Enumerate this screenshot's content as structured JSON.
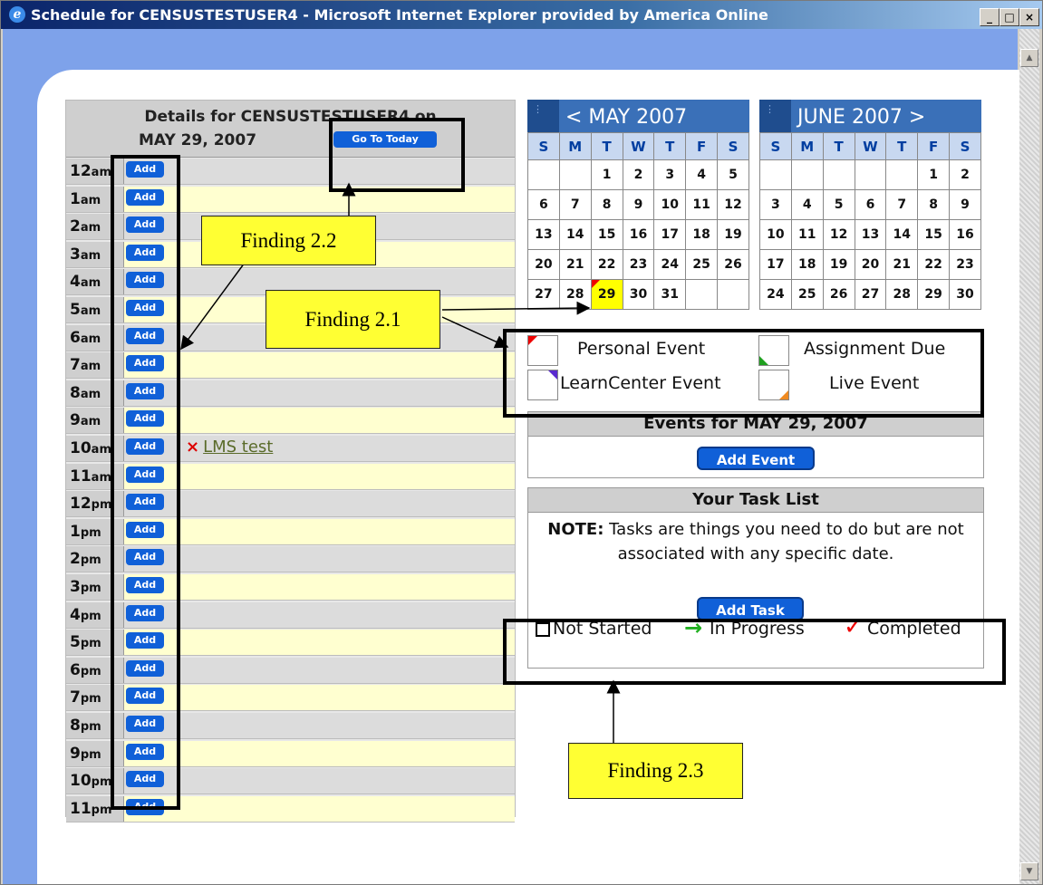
{
  "window": {
    "title": "Schedule for CENSUSTESTUSER4 - Microsoft Internet Explorer provided by America Online",
    "minimize": "_",
    "maximize": "□",
    "close": "×",
    "icon": "ie-icon"
  },
  "details": {
    "heading_line1": "Details for CENSUSTESTUSER4 on",
    "heading_line2": "MAY 29, 2007",
    "goto_today_label": "Go To Today",
    "add_label": "Add",
    "hours": [
      {
        "num": "12",
        "ap": "am"
      },
      {
        "num": "1",
        "ap": "am"
      },
      {
        "num": "2",
        "ap": "am"
      },
      {
        "num": "3",
        "ap": "am"
      },
      {
        "num": "4",
        "ap": "am"
      },
      {
        "num": "5",
        "ap": "am"
      },
      {
        "num": "6",
        "ap": "am"
      },
      {
        "num": "7",
        "ap": "am"
      },
      {
        "num": "8",
        "ap": "am"
      },
      {
        "num": "9",
        "ap": "am"
      },
      {
        "num": "10",
        "ap": "am"
      },
      {
        "num": "11",
        "ap": "am"
      },
      {
        "num": "12",
        "ap": "pm"
      },
      {
        "num": "1",
        "ap": "pm"
      },
      {
        "num": "2",
        "ap": "pm"
      },
      {
        "num": "3",
        "ap": "pm"
      },
      {
        "num": "4",
        "ap": "pm"
      },
      {
        "num": "5",
        "ap": "pm"
      },
      {
        "num": "6",
        "ap": "pm"
      },
      {
        "num": "7",
        "ap": "pm"
      },
      {
        "num": "8",
        "ap": "pm"
      },
      {
        "num": "9",
        "ap": "pm"
      },
      {
        "num": "10",
        "ap": "pm"
      },
      {
        "num": "11",
        "ap": "pm"
      }
    ],
    "event": {
      "hour_index": 10,
      "delete_glyph": "×",
      "label": "LMS test"
    }
  },
  "calendars": [
    {
      "title": "< MAY 2007",
      "days_of_week": [
        "S",
        "M",
        "T",
        "W",
        "T",
        "F",
        "S"
      ],
      "weeks": [
        [
          "",
          "",
          "1",
          "2",
          "3",
          "4",
          "5"
        ],
        [
          "6",
          "7",
          "8",
          "9",
          "10",
          "11",
          "12"
        ],
        [
          "13",
          "14",
          "15",
          "16",
          "17",
          "18",
          "19"
        ],
        [
          "20",
          "21",
          "22",
          "23",
          "24",
          "25",
          "26"
        ],
        [
          "27",
          "28",
          "29",
          "30",
          "31",
          "",
          ""
        ]
      ],
      "today": "29"
    },
    {
      "title": "JUNE 2007 >",
      "days_of_week": [
        "S",
        "M",
        "T",
        "W",
        "T",
        "F",
        "S"
      ],
      "weeks": [
        [
          "",
          "",
          "",
          "",
          "",
          "1",
          "2"
        ],
        [
          "3",
          "4",
          "5",
          "6",
          "7",
          "8",
          "9"
        ],
        [
          "10",
          "11",
          "12",
          "13",
          "14",
          "15",
          "16"
        ],
        [
          "17",
          "18",
          "19",
          "20",
          "21",
          "22",
          "23"
        ],
        [
          "24",
          "25",
          "26",
          "27",
          "28",
          "29",
          "30"
        ]
      ],
      "today": ""
    }
  ],
  "legend": {
    "personal": {
      "label": "Personal Event",
      "color": "#e00000"
    },
    "assignment": {
      "label": "Assignment Due",
      "color": "#20a020"
    },
    "learncenter": {
      "label": "LearnCenter Event",
      "color": "#5a2ad0"
    },
    "live": {
      "label": "Live Event",
      "color": "#f08a20"
    }
  },
  "events_panel": {
    "heading": "Events for MAY 29, 2007",
    "add_event_label": "Add Event"
  },
  "tasks_panel": {
    "heading": "Your Task List",
    "note_bold": "NOTE:",
    "note_text": " Tasks are things you need to do but are not associated with any specific date.",
    "add_task_label": "Add Task",
    "status_not_started": "Not Started",
    "status_in_progress": "In Progress",
    "status_completed": "Completed",
    "colors": {
      "in_progress": "#20b020",
      "completed": "#e00000"
    }
  },
  "annotations": {
    "finding_2_1": "Finding 2.1",
    "finding_2_2": "Finding 2.2",
    "finding_2_3": "Finding 2.3"
  }
}
